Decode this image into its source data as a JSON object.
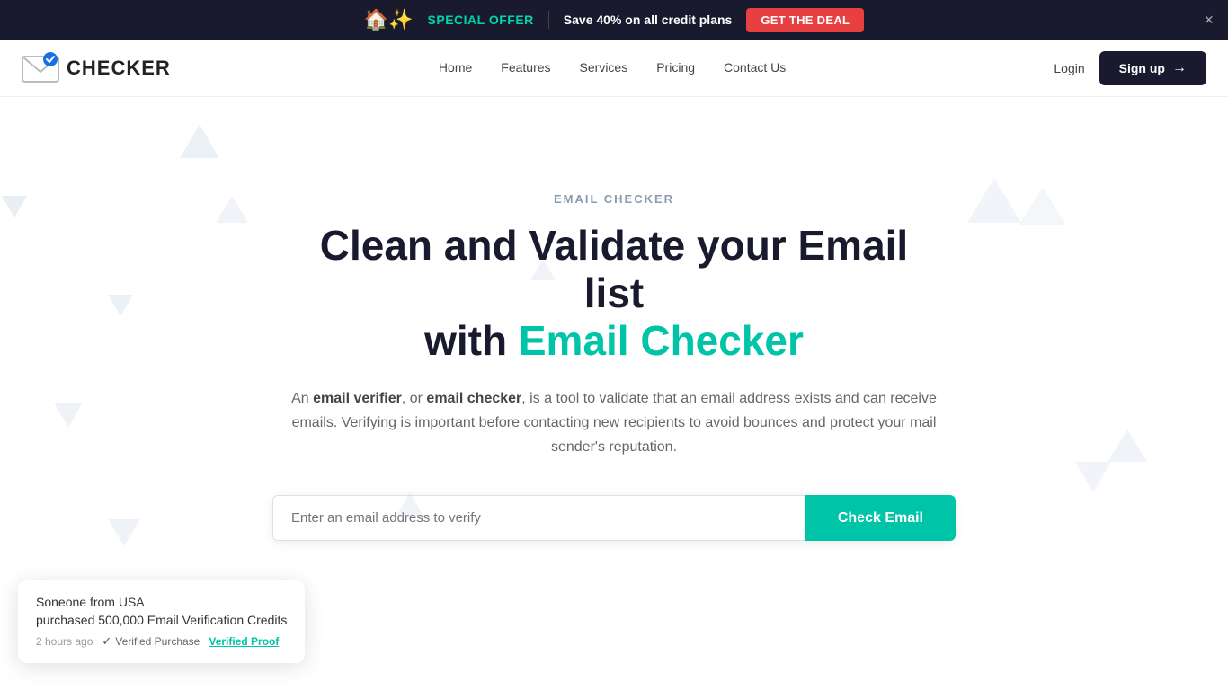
{
  "banner": {
    "special_offer": "SPECIAL OFFER",
    "save_text": "Save 40% on all credit plans",
    "cta_label": "GET THE DEAL",
    "close_label": "×"
  },
  "navbar": {
    "logo_text": "CHECKER",
    "nav_links": [
      {
        "label": "Home",
        "href": "#"
      },
      {
        "label": "Features",
        "href": "#"
      },
      {
        "label": "Services",
        "href": "#"
      },
      {
        "label": "Pricing",
        "href": "#"
      },
      {
        "label": "Contact Us",
        "href": "#"
      }
    ],
    "login_label": "Login",
    "signup_label": "Sign up"
  },
  "hero": {
    "section_label": "EMAIL CHECKER",
    "heading_part1": "Clean and Validate your Email list",
    "heading_part2": "with ",
    "heading_highlight": "Email Checker",
    "description_part1": "An ",
    "bold1": "email verifier",
    "description_part2": ", or ",
    "bold2": "email checker",
    "description_part3": ", is a tool to validate that an email address exists and can receive emails. Verifying is important before contacting new recipients to avoid bounces and protect your mail sender's reputation.",
    "input_placeholder": "Enter an email address to verify",
    "check_button": "Check Email"
  },
  "notification": {
    "main_text": "Soneone from USA",
    "sub_text": "purchased 500,000 Email Verification Credits",
    "time_text": "2 hours ago",
    "verified_text": "Verified Purchase",
    "proof_text": "Verified Proof"
  },
  "colors": {
    "accent": "#00c4a7",
    "dark": "#1a1a2e",
    "red": "#e84040"
  }
}
